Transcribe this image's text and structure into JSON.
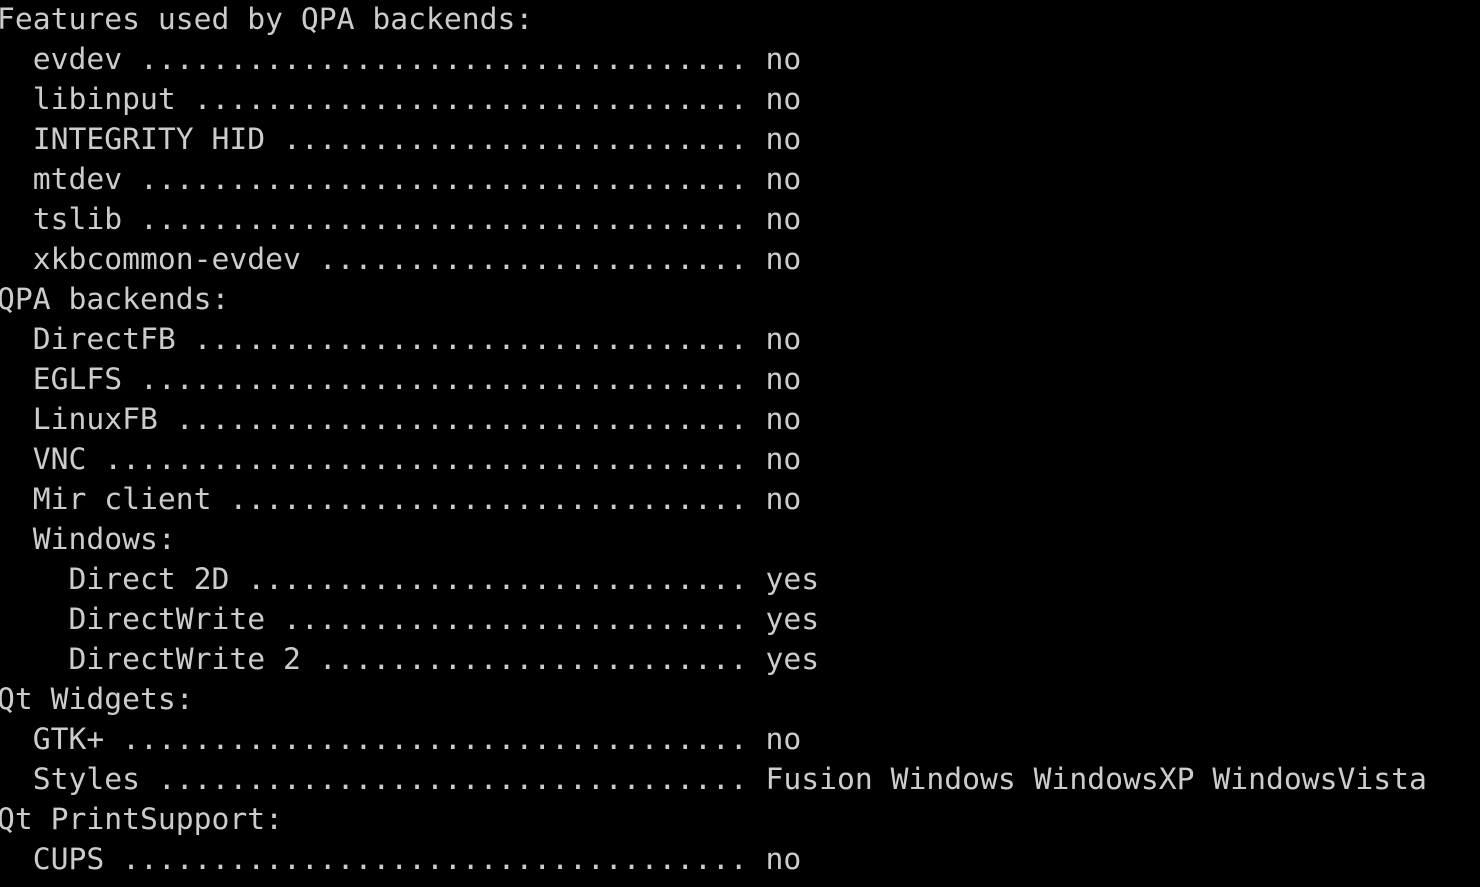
{
  "terminal": {
    "lines": [
      "Features used by QPA backends:",
      "  evdev .................................. no",
      "  libinput ............................... no",
      "  INTEGRITY HID .......................... no",
      "  mtdev .................................. no",
      "  tslib .................................. no",
      "  xkbcommon-evdev ........................ no",
      "QPA backends:",
      "  DirectFB ............................... no",
      "  EGLFS .................................. no",
      "  LinuxFB ................................ no",
      "  VNC .................................... no",
      "  Mir client ............................. no",
      "  Windows:",
      "    Direct 2D ............................ yes",
      "    DirectWrite .......................... yes",
      "    DirectWrite 2 ........................ yes",
      "Qt Widgets:",
      "  GTK+ ................................... no",
      "  Styles ................................. Fusion Windows WindowsXP WindowsVista",
      "Qt PrintSupport:",
      "  CUPS ................................... no"
    ]
  }
}
